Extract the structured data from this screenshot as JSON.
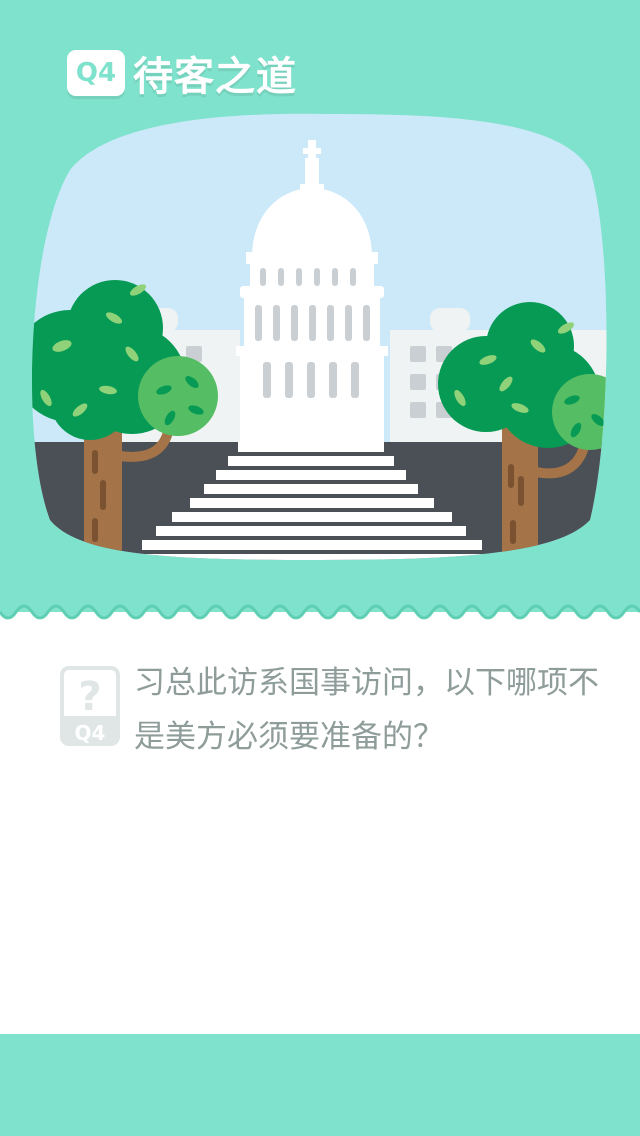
{
  "header": {
    "badge": "Q4",
    "title": "待客之道"
  },
  "question": {
    "icon_mark": "?",
    "icon_badge": "Q4",
    "text": "习总此访系国事访问，以下哪项不是美方必须要准备的？"
  },
  "colors": {
    "mint": "#7fe2cc",
    "sky": "#cce9fa",
    "tree_dark": "#069a54",
    "tree_light": "#55bd64",
    "trunk": "#a47448",
    "road": "#4b4f56"
  }
}
